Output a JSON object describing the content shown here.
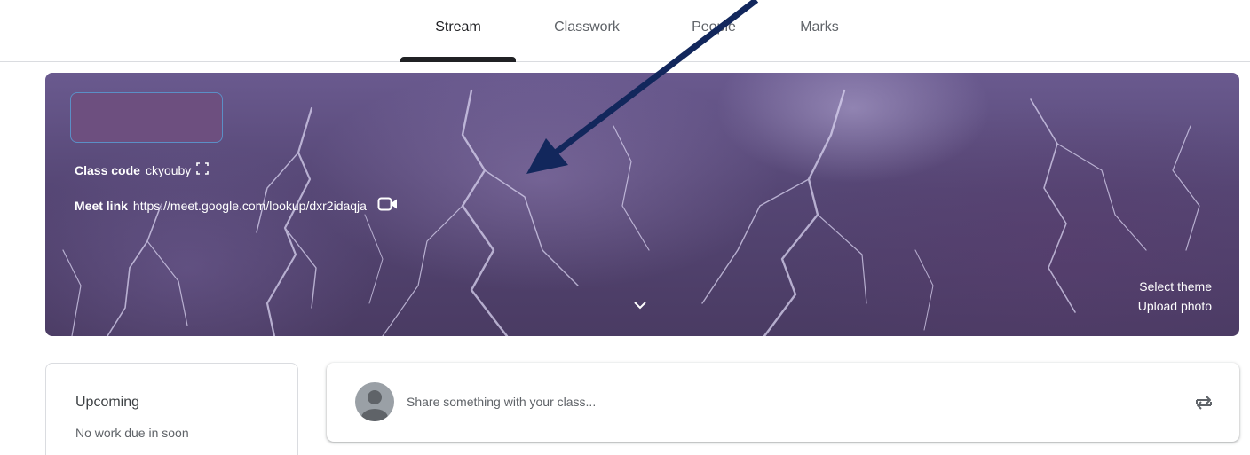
{
  "tabs": [
    {
      "label": "Stream",
      "active": true
    },
    {
      "label": "Classwork",
      "active": false
    },
    {
      "label": "People",
      "active": false
    },
    {
      "label": "Marks",
      "active": false
    }
  ],
  "banner": {
    "class_code_label": "Class code",
    "class_code": "ckyouby",
    "meet_link_label": "Meet link",
    "meet_link": "https://meet.google.com/lookup/dxr2idaqja",
    "select_theme": "Select theme",
    "upload_photo": "Upload photo"
  },
  "upcoming": {
    "title": "Upcoming",
    "subtitle": "No work due in soon"
  },
  "share": {
    "placeholder": "Share something with your class..."
  },
  "colors": {
    "accent": "#202124",
    "annotation_arrow": "#12275c",
    "class_box": "#6d4f7f"
  },
  "icons": {
    "copy": "fullscreen-corners-icon",
    "video": "video-camera-icon",
    "expand": "chevron-down-icon",
    "repost": "repost-icon"
  }
}
